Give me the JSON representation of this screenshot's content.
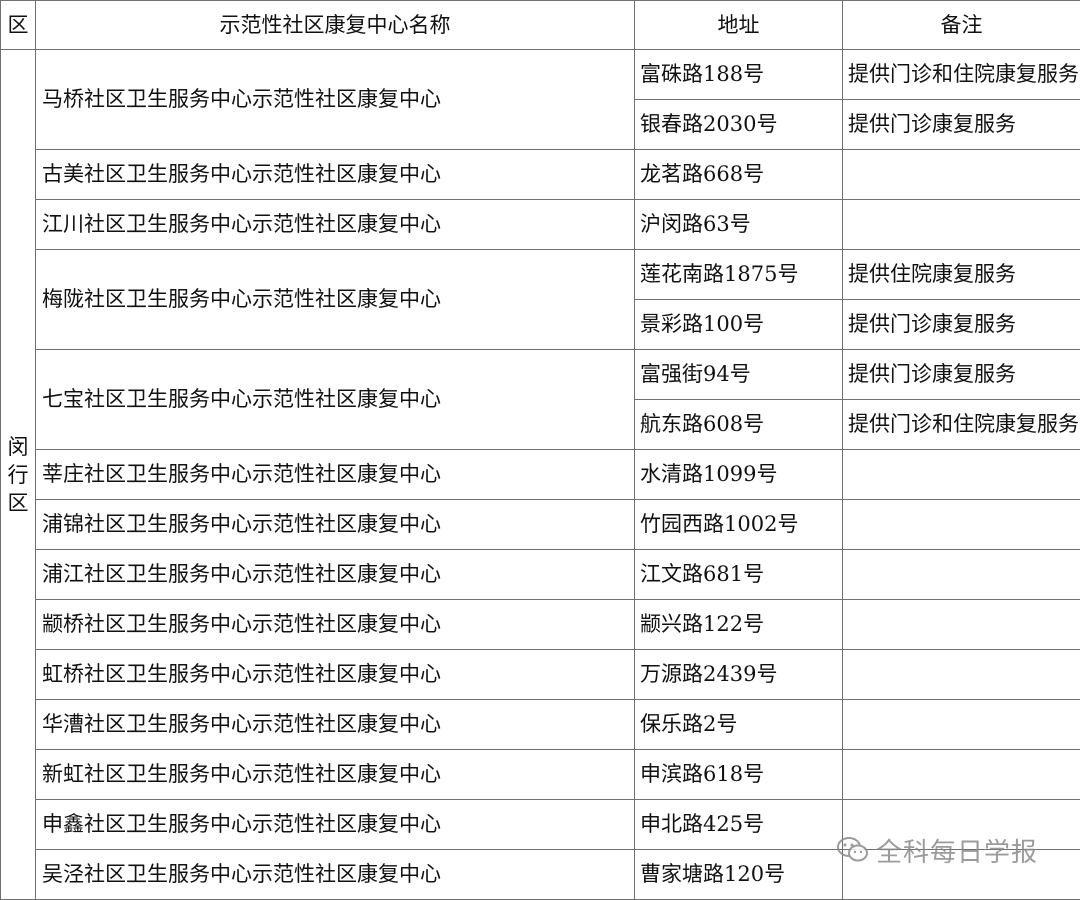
{
  "headers": {
    "district": "区",
    "name": "示范性社区康复中心名称",
    "address": "地址",
    "note": "备注"
  },
  "district": "闵行区",
  "centers": [
    {
      "name": "马桥社区卫生服务中心示范性社区康复中心",
      "sites": [
        {
          "address": "富硃路188号",
          "note": "提供门诊和住院康复服务"
        },
        {
          "address": "银春路2030号",
          "note": "提供门诊康复服务"
        }
      ]
    },
    {
      "name": "古美社区卫生服务中心示范性社区康复中心",
      "sites": [
        {
          "address": "龙茗路668号",
          "note": ""
        }
      ]
    },
    {
      "name": "江川社区卫生服务中心示范性社区康复中心",
      "sites": [
        {
          "address": "沪闵路63号",
          "note": ""
        }
      ]
    },
    {
      "name": "梅陇社区卫生服务中心示范性社区康复中心",
      "sites": [
        {
          "address": "莲花南路1875号",
          "note": "提供住院康复服务"
        },
        {
          "address": "景彩路100号",
          "note": "提供门诊康复服务"
        }
      ]
    },
    {
      "name": "七宝社区卫生服务中心示范性社区康复中心",
      "sites": [
        {
          "address": "富强街94号",
          "note": "提供门诊康复服务"
        },
        {
          "address": "航东路608号",
          "note": "提供门诊和住院康复服务"
        }
      ]
    },
    {
      "name": "莘庄社区卫生服务中心示范性社区康复中心",
      "sites": [
        {
          "address": "水清路1099号",
          "note": ""
        }
      ]
    },
    {
      "name": "浦锦社区卫生服务中心示范性社区康复中心",
      "sites": [
        {
          "address": "竹园西路1002号",
          "note": ""
        }
      ]
    },
    {
      "name": "浦江社区卫生服务中心示范性社区康复中心",
      "sites": [
        {
          "address": "江文路681号",
          "note": ""
        }
      ]
    },
    {
      "name": "颛桥社区卫生服务中心示范性社区康复中心",
      "sites": [
        {
          "address": "颛兴路122号",
          "note": ""
        }
      ]
    },
    {
      "name": "虹桥社区卫生服务中心示范性社区康复中心",
      "sites": [
        {
          "address": "万源路2439号",
          "note": ""
        }
      ]
    },
    {
      "name": "华漕社区卫生服务中心示范性社区康复中心",
      "sites": [
        {
          "address": "保乐路2号",
          "note": ""
        }
      ]
    },
    {
      "name": "新虹社区卫生服务中心示范性社区康复中心",
      "sites": [
        {
          "address": "申滨路618号",
          "note": ""
        }
      ]
    },
    {
      "name": "申鑫社区卫生服务中心示范性社区康复中心",
      "sites": [
        {
          "address": "申北路425号",
          "note": ""
        }
      ]
    },
    {
      "name": "吴泾社区卫生服务中心示范性社区康复中心",
      "sites": [
        {
          "address": "曹家塘路120号",
          "note": ""
        }
      ]
    }
  ],
  "watermark": {
    "text": "全科每日学报",
    "icon": "wechat-icon"
  }
}
